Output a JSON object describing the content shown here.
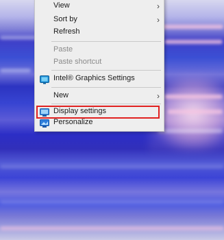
{
  "context_menu": {
    "items": [
      {
        "label": "View",
        "has_submenu": true
      },
      {
        "label": "Sort by",
        "has_submenu": true
      },
      {
        "label": "Refresh"
      },
      {
        "label": "Paste",
        "disabled": true
      },
      {
        "label": "Paste shortcut",
        "disabled": true
      },
      {
        "label": "Intel® Graphics Settings",
        "icon": "intel-graphics-icon"
      },
      {
        "label": "New",
        "has_submenu": true
      },
      {
        "label": "Display settings",
        "icon": "display-settings-icon",
        "highlighted": true
      },
      {
        "label": "Personalize",
        "icon": "personalize-icon"
      }
    ]
  },
  "colors": {
    "menu_background": "#eeeeee",
    "highlight_border": "#e0201f",
    "disabled_text": "#8a8a8a"
  }
}
